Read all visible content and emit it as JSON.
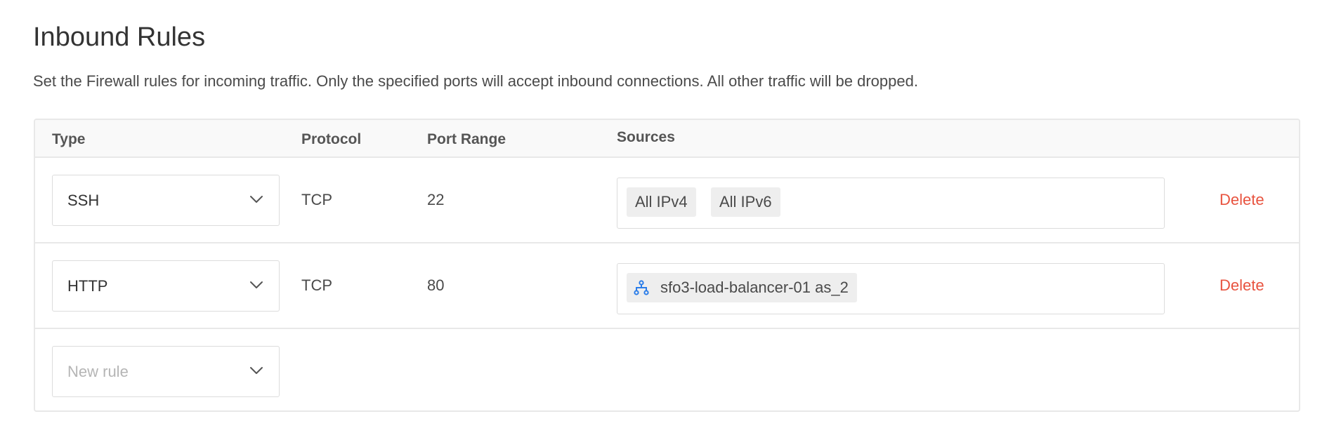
{
  "header": {
    "title": "Inbound Rules",
    "description": "Set the Firewall rules for incoming traffic. Only the specified ports will accept inbound connections. All other traffic will be dropped."
  },
  "table": {
    "columns": {
      "type": "Type",
      "protocol": "Protocol",
      "port_range": "Port Range",
      "sources": "Sources"
    },
    "rows": [
      {
        "type": "SSH",
        "protocol": "TCP",
        "port_range": "22",
        "sources": [
          "All IPv4",
          "All IPv6"
        ],
        "delete_label": "Delete"
      },
      {
        "type": "HTTP",
        "protocol": "TCP",
        "port_range": "80",
        "sources": [
          "sfo3-load-balancer-01 as_2"
        ],
        "source_icon": "load-balancer-icon",
        "delete_label": "Delete"
      }
    ],
    "new_rule": {
      "placeholder": "New rule"
    }
  },
  "colors": {
    "delete": "#e8533f",
    "load_balancer_icon": "#2b7de9",
    "border": "#e8e8e8",
    "header_bg": "#f9f9f9",
    "tag_bg": "#eeeeee"
  },
  "icons": {
    "chevron": "chevron-down-icon",
    "load_balancer": "load-balancer-icon"
  }
}
